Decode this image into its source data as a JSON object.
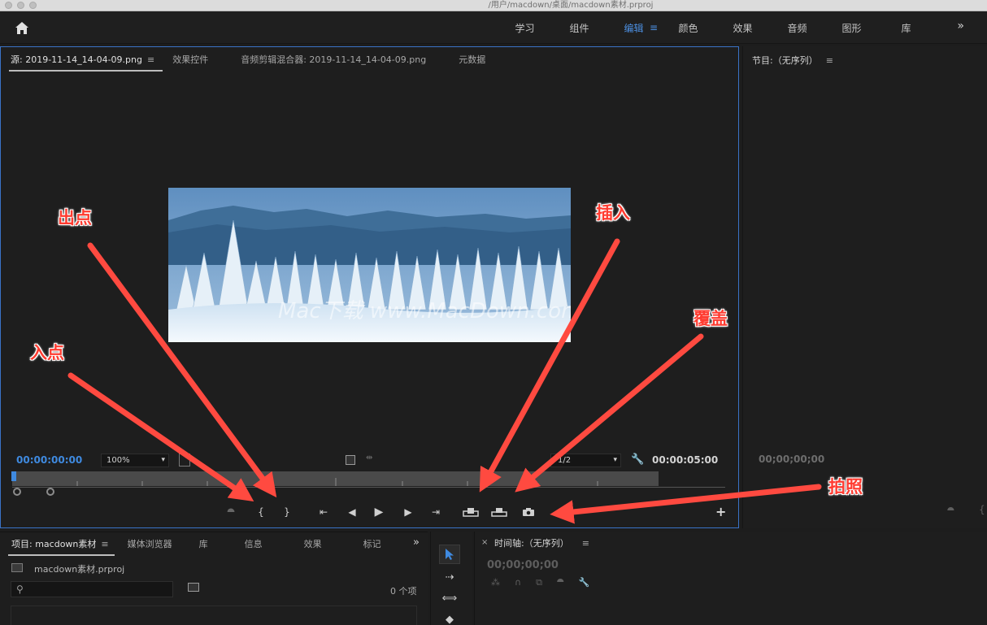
{
  "titlebar": {
    "path": "/用户/macdown/桌面/macdown素材.prproj"
  },
  "header": {
    "workspaces": [
      "学习",
      "组件",
      "编辑",
      "颜色",
      "效果",
      "音频",
      "图形",
      "库"
    ],
    "active_workspace": "编辑"
  },
  "source_panel": {
    "tabs": [
      "源: 2019-11-14_14-04-09.png",
      "效果控件",
      "音频剪辑混合器: 2019-11-14_14-04-09.png",
      "元数据"
    ],
    "timecode_in": "00:00:00:00",
    "timecode_duration": "00:00:05:00",
    "zoom": "100%",
    "resolution": "1/2",
    "watermark": "Mac下载 www.MacDown.com"
  },
  "program_panel": {
    "title": "节目:（无序列）",
    "timecode": "00;00;00;00"
  },
  "project_panel": {
    "tabs": [
      "项目: macdown素材",
      "媒体浏览器",
      "库",
      "信息",
      "效果",
      "标记"
    ],
    "file": "macdown素材.prproj",
    "search_placeholder": "",
    "item_count": "0 个项"
  },
  "timeline_panel": {
    "title": "时间轴:（无序列）",
    "timecode": "00;00;00;00"
  },
  "annotations": {
    "out_point": "出点",
    "in_point": "入点",
    "insert": "插入",
    "overwrite": "覆盖",
    "snapshot": "拍照"
  },
  "colors": {
    "accent": "#3f8ae0",
    "annotation": "#ff3b30",
    "panel_bg": "#1e1e1e"
  }
}
